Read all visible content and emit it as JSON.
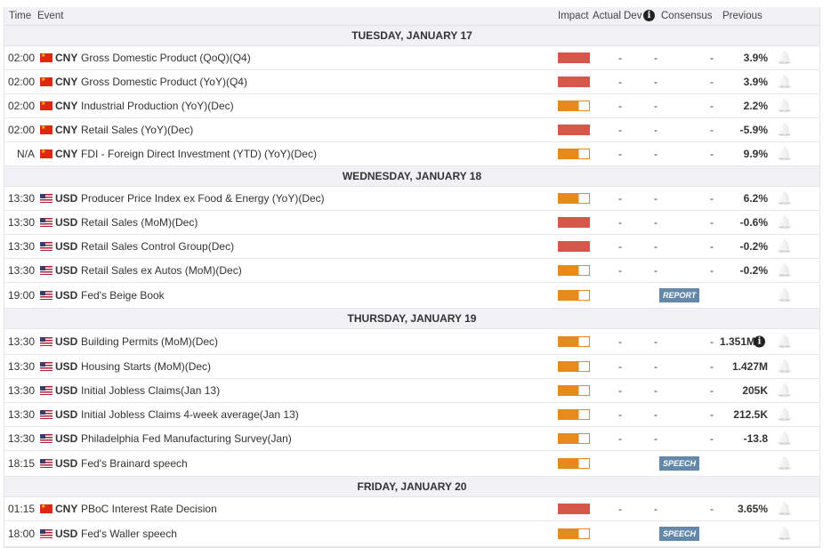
{
  "header": {
    "time": "Time",
    "event": "Event",
    "impact": "Impact",
    "actual": "Actual",
    "dev": "Dev",
    "consensus": "Consensus",
    "previous": "Previous"
  },
  "days": [
    {
      "label": "TUESDAY, JANUARY 17",
      "rows": [
        {
          "time": "02:00",
          "flag": "cny",
          "cur": "CNY",
          "event": "Gross Domestic Product (QoQ)(Q4)",
          "impact": "high",
          "actual": "-",
          "dev": "-",
          "consensus": "-",
          "previous": "3.9%"
        },
        {
          "time": "02:00",
          "flag": "cny",
          "cur": "CNY",
          "event": "Gross Domestic Product (YoY)(Q4)",
          "impact": "high",
          "actual": "-",
          "dev": "-",
          "consensus": "-",
          "previous": "3.9%"
        },
        {
          "time": "02:00",
          "flag": "cny",
          "cur": "CNY",
          "event": "Industrial Production (YoY)(Dec)",
          "impact": "medium",
          "actual": "-",
          "dev": "-",
          "consensus": "-",
          "previous": "2.2%"
        },
        {
          "time": "02:00",
          "flag": "cny",
          "cur": "CNY",
          "event": "Retail Sales (YoY)(Dec)",
          "impact": "high",
          "actual": "-",
          "dev": "-",
          "consensus": "-",
          "previous": "-5.9%"
        },
        {
          "time": "N/A",
          "flag": "cny",
          "cur": "CNY",
          "event": "FDI - Foreign Direct Investment (YTD) (YoY)(Dec)",
          "impact": "medium",
          "actual": "-",
          "dev": "-",
          "consensus": "-",
          "previous": "9.9%"
        }
      ]
    },
    {
      "label": "WEDNESDAY, JANUARY 18",
      "rows": [
        {
          "time": "13:30",
          "flag": "usd",
          "cur": "USD",
          "event": "Producer Price Index ex Food & Energy (YoY)(Dec)",
          "impact": "medium",
          "actual": "-",
          "dev": "-",
          "consensus": "-",
          "previous": "6.2%"
        },
        {
          "time": "13:30",
          "flag": "usd",
          "cur": "USD",
          "event": "Retail Sales (MoM)(Dec)",
          "impact": "high",
          "actual": "-",
          "dev": "-",
          "consensus": "-",
          "previous": "-0.6%"
        },
        {
          "time": "13:30",
          "flag": "usd",
          "cur": "USD",
          "event": "Retail Sales Control Group(Dec)",
          "impact": "high",
          "actual": "-",
          "dev": "-",
          "consensus": "-",
          "previous": "-0.2%"
        },
        {
          "time": "13:30",
          "flag": "usd",
          "cur": "USD",
          "event": "Retail Sales ex Autos (MoM)(Dec)",
          "impact": "medium",
          "actual": "-",
          "dev": "-",
          "consensus": "-",
          "previous": "-0.2%"
        },
        {
          "time": "19:00",
          "flag": "usd",
          "cur": "USD",
          "event": "Fed's Beige Book",
          "impact": "medium",
          "badge": "REPORT"
        }
      ]
    },
    {
      "label": "THURSDAY, JANUARY 19",
      "rows": [
        {
          "time": "13:30",
          "flag": "usd",
          "cur": "USD",
          "event": "Building Permits (MoM)(Dec)",
          "impact": "medium",
          "actual": "-",
          "dev": "-",
          "consensus": "-",
          "previous": "1.351M",
          "prev_info": true
        },
        {
          "time": "13:30",
          "flag": "usd",
          "cur": "USD",
          "event": "Housing Starts (MoM)(Dec)",
          "impact": "medium",
          "actual": "-",
          "dev": "-",
          "consensus": "-",
          "previous": "1.427M"
        },
        {
          "time": "13:30",
          "flag": "usd",
          "cur": "USD",
          "event": "Initial Jobless Claims(Jan 13)",
          "impact": "medium",
          "actual": "-",
          "dev": "-",
          "consensus": "-",
          "previous": "205K"
        },
        {
          "time": "13:30",
          "flag": "usd",
          "cur": "USD",
          "event": "Initial Jobless Claims 4-week average(Jan 13)",
          "impact": "medium",
          "actual": "-",
          "dev": "-",
          "consensus": "-",
          "previous": "212.5K"
        },
        {
          "time": "13:30",
          "flag": "usd",
          "cur": "USD",
          "event": "Philadelphia Fed Manufacturing Survey(Jan)",
          "impact": "medium",
          "actual": "-",
          "dev": "-",
          "consensus": "-",
          "previous": "-13.8"
        },
        {
          "time": "18:15",
          "flag": "usd",
          "cur": "USD",
          "event": "Fed's Brainard speech",
          "impact": "medium",
          "badge": "SPEECH"
        }
      ]
    },
    {
      "label": "FRIDAY, JANUARY 20",
      "rows": [
        {
          "time": "01:15",
          "flag": "cny",
          "cur": "CNY",
          "event": "PBoC Interest Rate Decision",
          "impact": "high",
          "actual": "-",
          "dev": "-",
          "consensus": "-",
          "previous": "3.65%"
        },
        {
          "time": "18:00",
          "flag": "usd",
          "cur": "USD",
          "event": "Fed's Waller speech",
          "impact": "medium",
          "badge": "SPEECH"
        }
      ]
    }
  ]
}
